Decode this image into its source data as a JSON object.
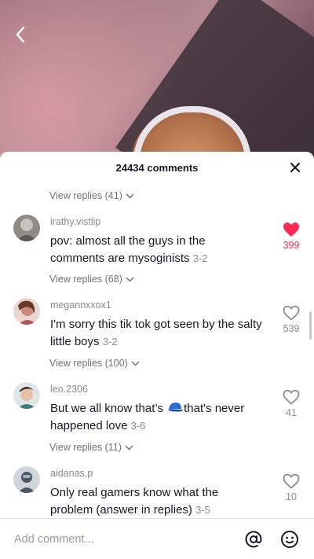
{
  "header": {
    "title": "24434 comments"
  },
  "footer": {
    "add_comment_placeholder": "Add comment..."
  },
  "comments": [
    {
      "view_replies_above": "View replies (41)"
    },
    {
      "username": "irathy.vistlip",
      "text": "pov: almost all the guys in the comments are mysoginists",
      "date": "3-2",
      "likes": "399",
      "liked": true,
      "replies": "View replies (68)"
    },
    {
      "username": "megannxxox1",
      "text": "I'm sorry this tik tok got seen by the salty little boys",
      "date": "3-2",
      "likes": "539",
      "liked": false,
      "replies": "View replies (100)"
    },
    {
      "username": "leo.2306",
      "text_before": "But we all know that’s ",
      "text_after": "that's never happened love",
      "date": "3-6",
      "likes": "41",
      "liked": false,
      "replies": "View replies (11)"
    },
    {
      "username": "aidanas.p",
      "text": "Only real gamers know what the problem (answer in replies)",
      "date": "3-5",
      "likes": "10",
      "liked": false
    }
  ],
  "colors": {
    "accent": "#fe2c55",
    "text": "#161823",
    "muted": "#8a8b91"
  },
  "icons": [
    "back-arrow-icon",
    "close-icon",
    "heart-icon",
    "chevron-down-icon",
    "at-mention-icon",
    "emoji-icon",
    "blue-cap-emoji"
  ]
}
